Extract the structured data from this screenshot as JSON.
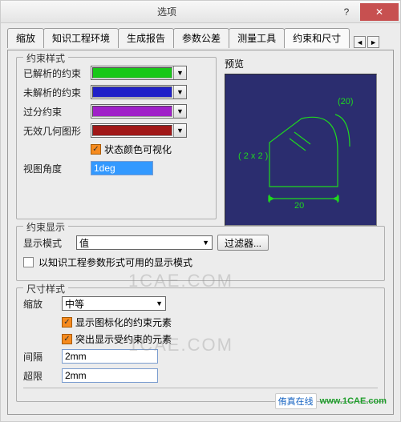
{
  "window": {
    "title": "选项",
    "help": "?",
    "close": "✕"
  },
  "tabs": {
    "items": [
      "缩放",
      "知识工程环境",
      "生成报告",
      "参数公差",
      "测量工具",
      "约束和尺寸"
    ],
    "active_index": 5
  },
  "constraint_style": {
    "group_title": "约束样式",
    "rows": [
      {
        "label": "已解析的约束",
        "color": "#18c818"
      },
      {
        "label": "未解析的约束",
        "color": "#2020c8"
      },
      {
        "label": "过分约束",
        "color": "#a020c8"
      },
      {
        "label": "无效几何图形",
        "color": "#a01818"
      }
    ],
    "state_color_label": "状态颜色可视化",
    "view_angle_label": "视图角度",
    "view_angle_value": "1deg"
  },
  "preview": {
    "label": "预览",
    "dims": {
      "top": "(20)",
      "left": "( 2 x 2 )",
      "bottom": "20"
    }
  },
  "constraint_display": {
    "group_title": "约束显示",
    "mode_label": "显示模式",
    "mode_value": "值",
    "filter_btn": "过滤器...",
    "ke_format_label": "以知识工程参数形式可用的显示模式"
  },
  "dim_style": {
    "group_title": "尺寸样式",
    "zoom_label": "缩放",
    "zoom_value": "中等",
    "show_marked_label": "显示图标化的约束元素",
    "highlight_label": "突出显示受约束的元素",
    "gap_label": "间隔",
    "gap_value": "2mm",
    "overrun_label": "超限",
    "overrun_value": "2mm"
  },
  "watermarks": {
    "a": "1CAE.COM",
    "b": "1CAE.COM"
  },
  "footer": {
    "brand": "侑真在线",
    "url": "www.1CAE.com"
  }
}
